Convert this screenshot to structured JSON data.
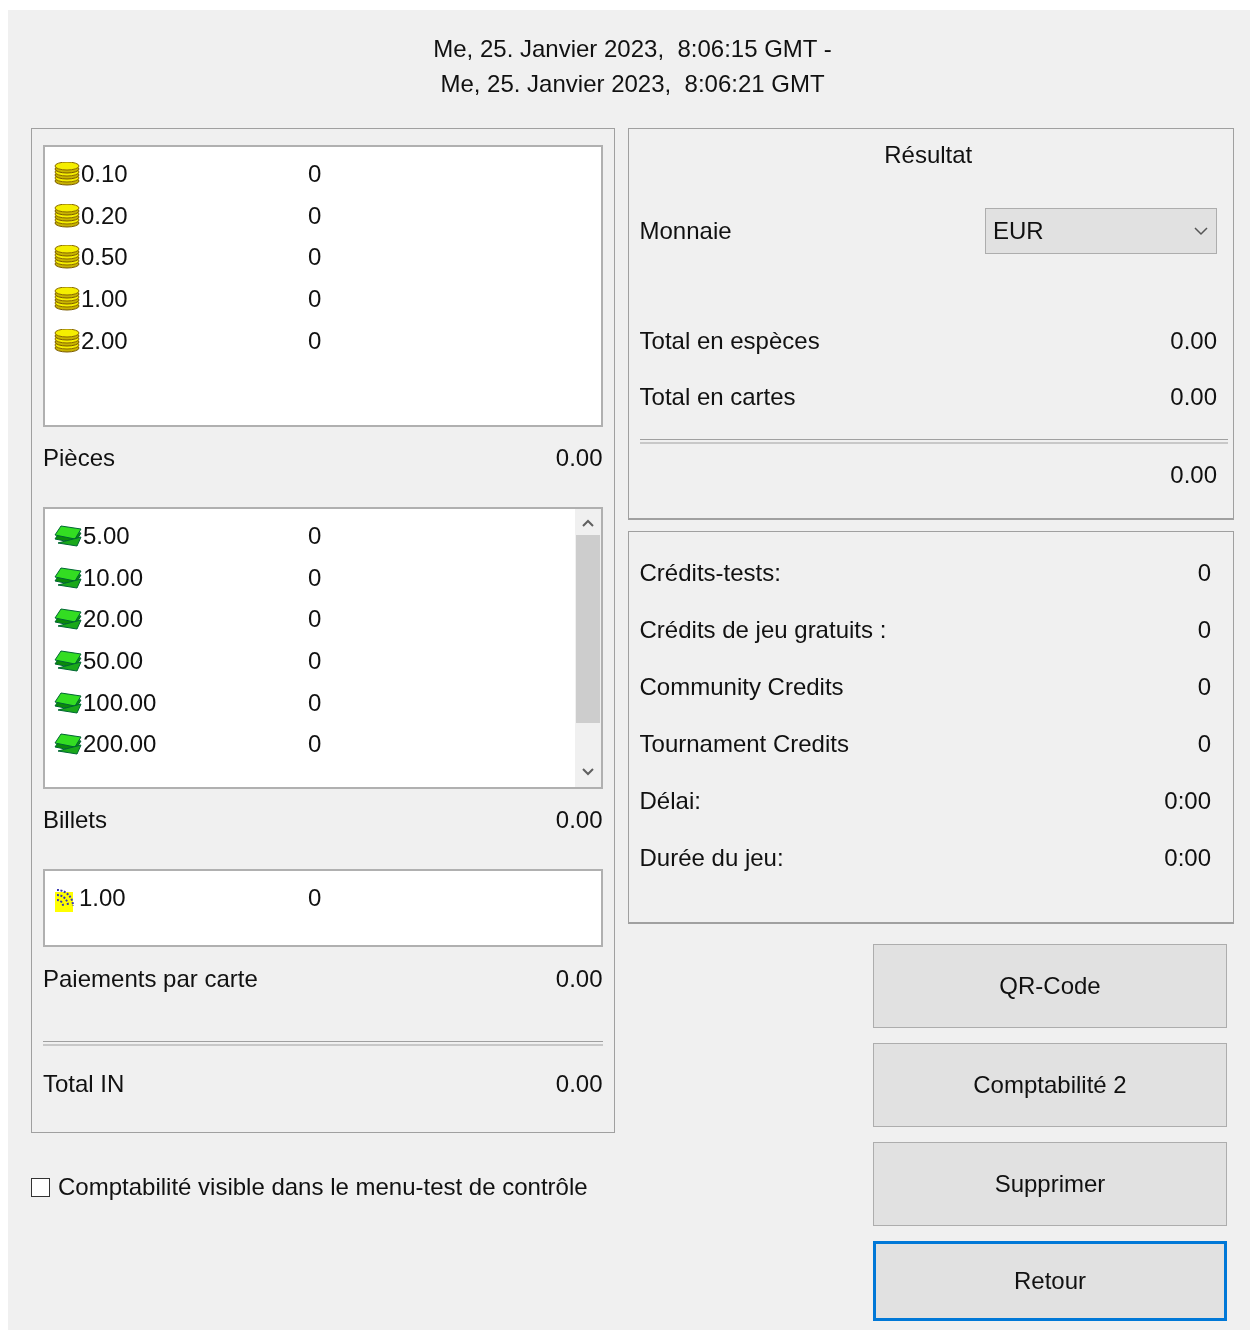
{
  "header": {
    "line_1": "Me, 25. Janvier 2023,  8:06:15 GMT -",
    "line_2": "Me, 25. Janvier 2023,  8:06:21 GMT"
  },
  "sections": [
    {
      "kind": "coin",
      "label": "Pièces",
      "total": "0.00",
      "scrollable": false,
      "items": [
        {
          "denomination": "0.10",
          "count": "0"
        },
        {
          "denomination": "0.20",
          "count": "0"
        },
        {
          "denomination": "0.50",
          "count": "0"
        },
        {
          "denomination": "1.00",
          "count": "0"
        },
        {
          "denomination": "2.00",
          "count": "0"
        }
      ]
    },
    {
      "kind": "bill",
      "label": "Billets",
      "total": "0.00",
      "scrollable": true,
      "items": [
        {
          "denomination": "5.00",
          "count": "0"
        },
        {
          "denomination": "10.00",
          "count": "0"
        },
        {
          "denomination": "20.00",
          "count": "0"
        },
        {
          "denomination": "50.00",
          "count": "0"
        },
        {
          "denomination": "100.00",
          "count": "0"
        },
        {
          "denomination": "200.00",
          "count": "0"
        }
      ]
    },
    {
      "kind": "card",
      "label": "Paiements par carte",
      "total": "0.00",
      "scrollable": false,
      "items": [
        {
          "denomination": "1.00",
          "count": "0"
        }
      ]
    }
  ],
  "total_in": {
    "label": "Total IN",
    "value": "0.00"
  },
  "visibility_checkbox": {
    "label": "Comptabilité visible dans le menu-test de contrôle",
    "checked": false
  },
  "result": {
    "title": "Résultat",
    "currency_label": "Monnaie",
    "currency": "EUR",
    "rows": [
      {
        "label": "Total en espèces",
        "value": "0.00"
      },
      {
        "label": "Total en cartes",
        "value": "0.00"
      }
    ],
    "grand_total": "0.00"
  },
  "credits": [
    {
      "label": "Crédits-tests:",
      "value": "0"
    },
    {
      "label": "Crédits de jeu gratuits :",
      "value": "0"
    },
    {
      "label": "Community Credits",
      "value": "0"
    },
    {
      "label": "Tournament Credits",
      "value": "0"
    },
    {
      "label": "Délai:",
      "value": "0:00"
    },
    {
      "label": "Durée du jeu:",
      "value": "0:00"
    }
  ],
  "buttons": [
    {
      "label": "QR-Code",
      "focused": false
    },
    {
      "label": "Comptabilité 2",
      "focused": false
    },
    {
      "label": "Supprimer",
      "focused": false
    },
    {
      "label": "Retour",
      "focused": true
    }
  ]
}
